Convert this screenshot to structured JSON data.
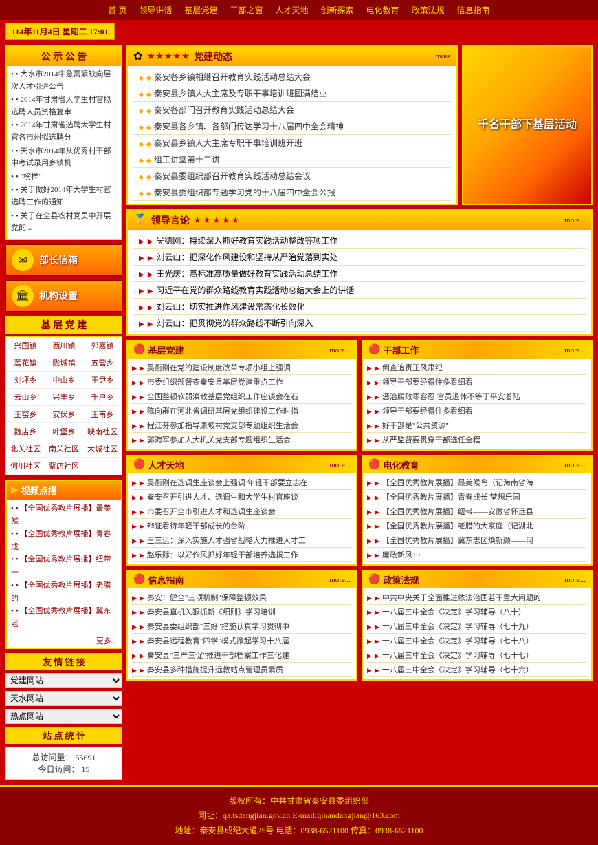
{
  "nav": {
    "items": [
      {
        "label": "首 页"
      },
      {
        "label": "－"
      },
      {
        "label": "领导讲话"
      },
      {
        "label": "－"
      },
      {
        "label": "基层党建"
      },
      {
        "label": "－"
      },
      {
        "label": "干部之窗"
      },
      {
        "label": "－"
      },
      {
        "label": "人才天地"
      },
      {
        "label": "－"
      },
      {
        "label": "创新探索"
      },
      {
        "label": "－"
      },
      {
        "label": "电化教育"
      },
      {
        "label": "－"
      },
      {
        "label": "政策法规"
      },
      {
        "label": "－"
      },
      {
        "label": "信息指南"
      }
    ]
  },
  "date_bar": {
    "text": "114年11月4日 星期二 17:01"
  },
  "notice": {
    "title": "公 示 公 告",
    "items": [
      "大水市2014牛急需紧缺向层次人才引进公告",
      "2014年甘肃省大学生村官拟选聘人员资格复审",
      "2014年甘肃省选聘大学生村官各市州拟选聘分",
      "天水市2014年从优秀村干部中考试录用乡镇机",
      "\"榜样\"",
      "关于做好2014年大学生村官选聘工作的通知",
      "关于在全县农村党员中开展党的..."
    ]
  },
  "sidebar_btn1": {
    "label": "部长信箱"
  },
  "sidebar_btn2": {
    "label": "机构设置"
  },
  "grassroots": {
    "title": "基 层 党 建",
    "links": [
      "兴国镇",
      "西川镇",
      "郭嘉镇",
      "莲花镇",
      "陇城镇",
      "五营乡",
      "刘坪乡",
      "中山乡",
      "王尹乡",
      "云山乡",
      "兴丰乡",
      "千户乡",
      "王窑乡",
      "安伏乡",
      "王甫乡",
      "魏店乡",
      "叶堡乡",
      "映南社区",
      "北关社区",
      "南关社区",
      "大城社区",
      "何川社区",
      "蔡店社区"
    ]
  },
  "video": {
    "title": "视频点播",
    "items": [
      "【全国优秀教片展播】最美候",
      "【全国优秀教片展播】青春成",
      "【全国优秀教片展播】纽带一",
      "【全国优秀教片展播】老腊的",
      "【全国优秀教片展播】冀东老"
    ],
    "more": "更多..."
  },
  "friendly_links": {
    "title": "友 情 链 接",
    "options": [
      {
        "label": "党建网站",
        "value": "1"
      },
      {
        "label": "天水网站",
        "value": "2"
      },
      {
        "label": "热点网站",
        "value": "3"
      }
    ]
  },
  "stats": {
    "title": "站 点 统 计",
    "total_label": "总访问量：",
    "total_value": "55691",
    "today_label": "今日访问：",
    "today_value": "15"
  },
  "party_news": {
    "title": "党建动态",
    "more": "more",
    "items": [
      "秦安各乡镇相继召开教育实践活动总结大会",
      "秦安县乡镇人大主席及专职干事培训班圆满结业",
      "秦安各部门召开教育实践活动总结大会",
      "秦安县各乡镇、各部门传达学习十八届四中全会精神",
      "秦安县乡镇人大主席专职干事培训班开班",
      "组工讲堂第十二讲",
      "秦安县委组织部召开教育实践活动总结会议",
      "秦安县委组织部专题学习党的十八届四中全会公报"
    ]
  },
  "banner": {
    "text": "千名干部下基层活动"
  },
  "leader": {
    "title": "领导言论",
    "more": "more...",
    "items": [
      "吴德刚：持续深入抓好教育实践活动整改等项工作",
      "刘云山：把深化作风建设和坚持从严治党落到实处",
      "王光庆：高标准高质量做好教育实践活动总结工作",
      "习近平在党的群众路线教育实践活动总结大会上的讲话",
      "刘云山：切实推进作风建设常态化长效化",
      "刘云山：把贯彻党的群众路线不断引向深入"
    ]
  },
  "box1": {
    "title": "基层党建",
    "more": "more...",
    "items": [
      "吴衙刚在党的建设制度改革专项小组上强调",
      "市委组织部督查秦安县基层党建重点工作",
      "全国整顿软弱涣散基层党组织工作座谈会在石",
      "陈向群在河北省调研基层党组织建设工作时指",
      "程江芬参加指导康坡村党支部专题组织生活会",
      "郭海军参加人大机关党支部专题组织生活会"
    ]
  },
  "box2": {
    "title": "干部工作",
    "more": "more...",
    "items": [
      "倒查追责正风肃纪",
      "领导干部要经得住多看细看",
      "惩治腐败零容忍 官员退休不等于平安着陆",
      "领导干部要经得住多看细看",
      "好干部是\"公共资源\"",
      "从严监督要贯穿干部选任全程"
    ]
  },
  "box3": {
    "title": "人才天地",
    "more": "more...",
    "items": [
      "吴衙刚在选调生座谈会上强调 年轻干部要立志在",
      "秦安召开引进人才、选调生和大学生村官座谈",
      "市委召开全市引进人才和选调生座谈会",
      "辩证看待年轻干部成长的台阶",
      "王三运：深入实施人才强省战略大力推进人才工",
      "赵乐际：以好作风抓好年轻干部培养选拔工作"
    ]
  },
  "box4": {
    "title": "电化教育",
    "more": "more...",
    "items": [
      "【全国优秀教片展播】最美候鸟（记海南省海",
      "【全国优秀教片展播】青春成长 梦想乐园",
      "【全国优秀教片展播】纽带——安徽省怀远县",
      "【全国优秀教片展播】老腊的大家庭（记湖北",
      "【全国优秀教片展播】冀东志区焕新颜——河",
      "廉政新风10"
    ]
  },
  "box5": {
    "title": "信息指南",
    "more": "more...",
    "items": [
      "秦安：健全\"三项机制\"保障整顿效果",
      "秦安县直机关狠抓新《细则》学习培训",
      "秦安县委组织部\"三好\"措施认真学习贯彻中",
      "秦安县远程教育\"四学\"模式掀起学习十八届",
      "秦安县\"三严三促\"推进干部档案工作三化建",
      "秦安县多种措施提升远教站点管理员素质"
    ]
  },
  "box6": {
    "title": "政策法规",
    "more": "more...",
    "items": [
      "中共中央关于全面推进依法治国若干重大问题的",
      "十八届三中全会《决定》学习辅导（八十）",
      "十八届三中全会《决定》学习辅导（七十九）",
      "十八届三中全会《决定》学习辅导（七十八）",
      "十八届三中全会《决定》学习辅导（七十七）",
      "十八届三中全会《决定》学习辅导（七十六）"
    ]
  },
  "more_section": {
    "label": "More"
  },
  "footer": {
    "copyright": "版权所有：中共甘肃省秦安县委组织部",
    "website": "网址：qa.tsdangjian.gov.cn  E-mail:qinandangjian@163.com",
    "address": "地址：秦安县成纪大道25号  电话：0938-6521100  传真：0938-6521100"
  }
}
